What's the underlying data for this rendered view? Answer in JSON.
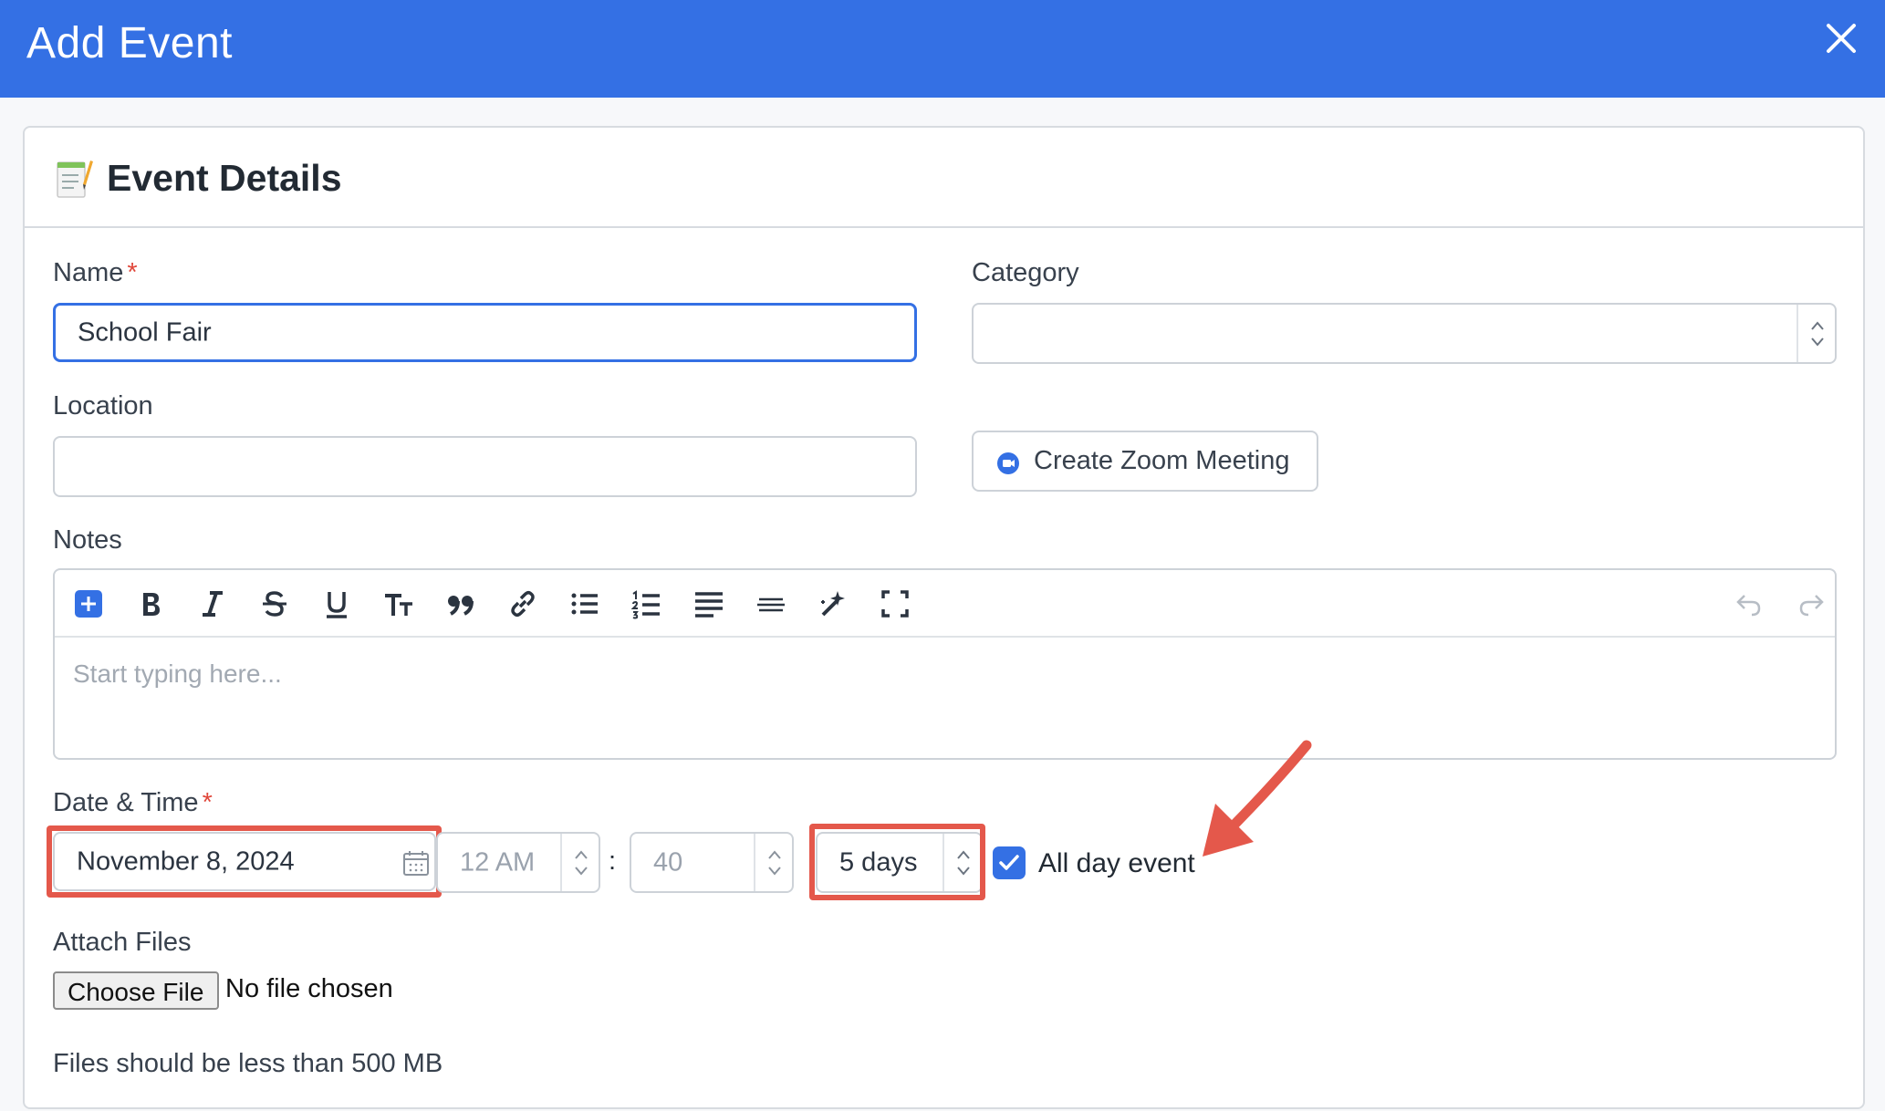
{
  "dialog": {
    "title": "Add Event"
  },
  "card": {
    "title": "Event Details"
  },
  "form": {
    "name": {
      "label": "Name",
      "required_mark": "*",
      "value": "School Fair"
    },
    "category": {
      "label": "Category",
      "value": ""
    },
    "location": {
      "label": "Location",
      "value": ""
    },
    "zoom_button": {
      "label": "Create Zoom Meeting"
    },
    "notes": {
      "label": "Notes",
      "placeholder": "Start typing here..."
    },
    "datetime": {
      "label": "Date & Time",
      "required_mark": "*",
      "date": "November 8, 2024",
      "hour": "12 AM",
      "separator": ":",
      "minute": "40",
      "duration": "5 days",
      "all_day_label": "All day event",
      "all_day_checked": true
    },
    "attach": {
      "label": "Attach Files",
      "button": "Choose File",
      "status": "No file chosen",
      "hint": "Files should be less than 500 MB"
    }
  },
  "toolbar_icons": [
    "add-block-icon",
    "bold-icon",
    "italic-icon",
    "strikethrough-icon",
    "underline-icon",
    "text-size-icon",
    "quote-icon",
    "link-icon",
    "bulleted-list-icon",
    "numbered-list-icon",
    "align-icon",
    "horizontal-rule-icon",
    "magic-format-icon",
    "fullscreen-icon",
    "undo-icon",
    "redo-icon"
  ],
  "colors": {
    "header": "#3470e4",
    "accent": "#3470e4",
    "highlight": "#e4584b",
    "required": "#e0473b"
  }
}
